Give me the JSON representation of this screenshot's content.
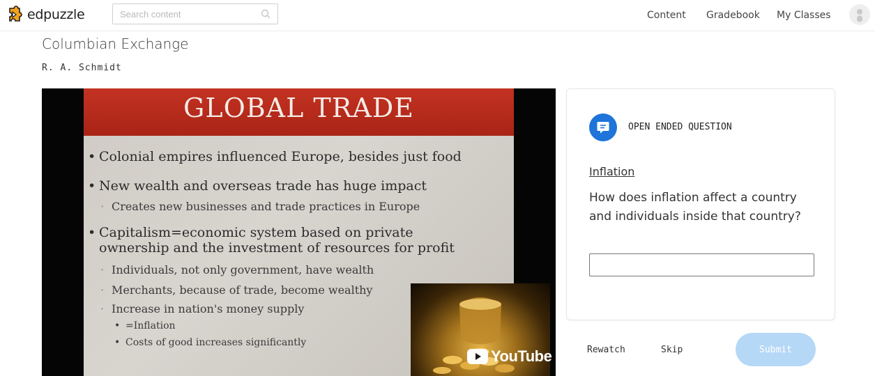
{
  "app": {
    "brand": "edpuzzle",
    "search_placeholder": "Search content",
    "nav": [
      "Content",
      "Gradebook",
      "My Classes"
    ]
  },
  "lesson": {
    "title": "Columbian Exchange",
    "author": "R. A. Schmidt"
  },
  "video": {
    "slide_title": "GLOBAL TRADE",
    "bullets": [
      "Colonial empires influenced Europe, besides just food",
      "New wealth and overseas trade has huge impact",
      "Creates new businesses and trade practices in Europe",
      "Capitalism=economic system based on private",
      "ownership and the investment of resources for profit",
      "Individuals, not only government, have wealth",
      "Merchants, because of trade, become wealthy",
      "Increase in nation's money supply",
      "=Inflation",
      "Costs of good increases significantly"
    ],
    "provider": "YouTube"
  },
  "question": {
    "type_label": "OPEN ENDED QUESTION",
    "topic": "Inflation",
    "text": "How does inflation affect a country and individuals inside that country?",
    "answer_value": ""
  },
  "actions": {
    "rewatch": "Rewatch",
    "skip": "Skip",
    "submit": "Submit"
  },
  "colors": {
    "accent": "#1e74d8",
    "submit_disabled": "#b6d8f7",
    "slide_header": "#b52a1b"
  }
}
